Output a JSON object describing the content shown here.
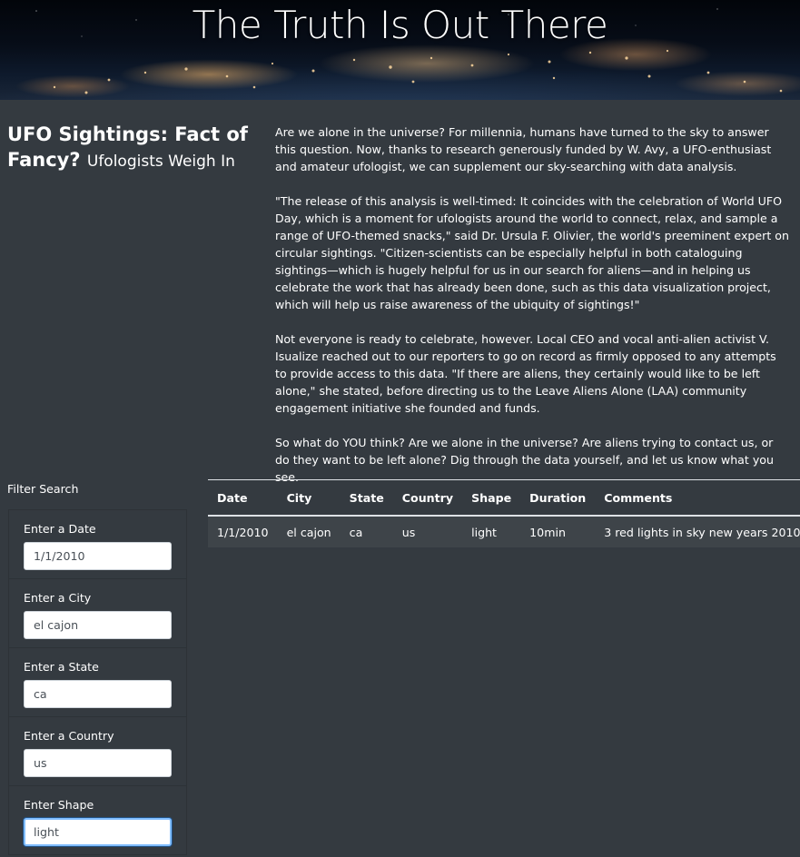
{
  "hero": {
    "title": "The Truth Is Out There"
  },
  "article": {
    "heading": "UFO Sightings: Fact of Fancy?",
    "subheading": "Ufologists Weigh In",
    "paragraphs": [
      "Are we alone in the universe? For millennia, humans have turned to the sky to answer this question. Now, thanks to research generously funded by W. Avy, a UFO-enthusiast and amateur ufologist, we can supplement our sky-searching with data analysis.",
      "\"The release of this analysis is well-timed: It coincides with the celebration of World UFO Day, which is a moment for ufologists around the world to connect, relax, and sample a range of UFO-themed snacks,\" said Dr. Ursula F. Olivier, the world's preeminent expert on circular sightings. \"Citizen-scientists can be especially helpful in both cataloguing sightings—which is hugely helpful for us in our search for aliens—and in helping us celebrate the work that has already been done, such as this data visualization project, which will help us raise awareness of the ubiquity of sightings!\"",
      "Not everyone is ready to celebrate, however. Local CEO and vocal anti-alien activist V. Isualize reached out to our reporters to go on record as firmly opposed to any attempts to provide access to this data. \"If there are aliens, they certainly would like to be left alone,\" she stated, before directing us to the Leave Aliens Alone (LAA) community engagement initiative she founded and funds.",
      "So what do YOU think? Are we alone in the universe? Are aliens trying to contact us, or do they want to be left alone? Dig through the data yourself, and let us know what you see."
    ]
  },
  "filters": {
    "title": "Filter Search",
    "items": [
      {
        "label": "Enter a Date",
        "value": "1/1/2010"
      },
      {
        "label": "Enter a City",
        "value": "el cajon"
      },
      {
        "label": "Enter a State",
        "value": "ca"
      },
      {
        "label": "Enter a Country",
        "value": "us"
      },
      {
        "label": "Enter Shape",
        "value": "light"
      }
    ]
  },
  "table": {
    "columns": [
      "Date",
      "City",
      "State",
      "Country",
      "Shape",
      "Duration",
      "Comments"
    ],
    "rows": [
      [
        "1/1/2010",
        "el cajon",
        "ca",
        "us",
        "light",
        "10min",
        "3 red lights in sky new years 2010"
      ]
    ]
  }
}
